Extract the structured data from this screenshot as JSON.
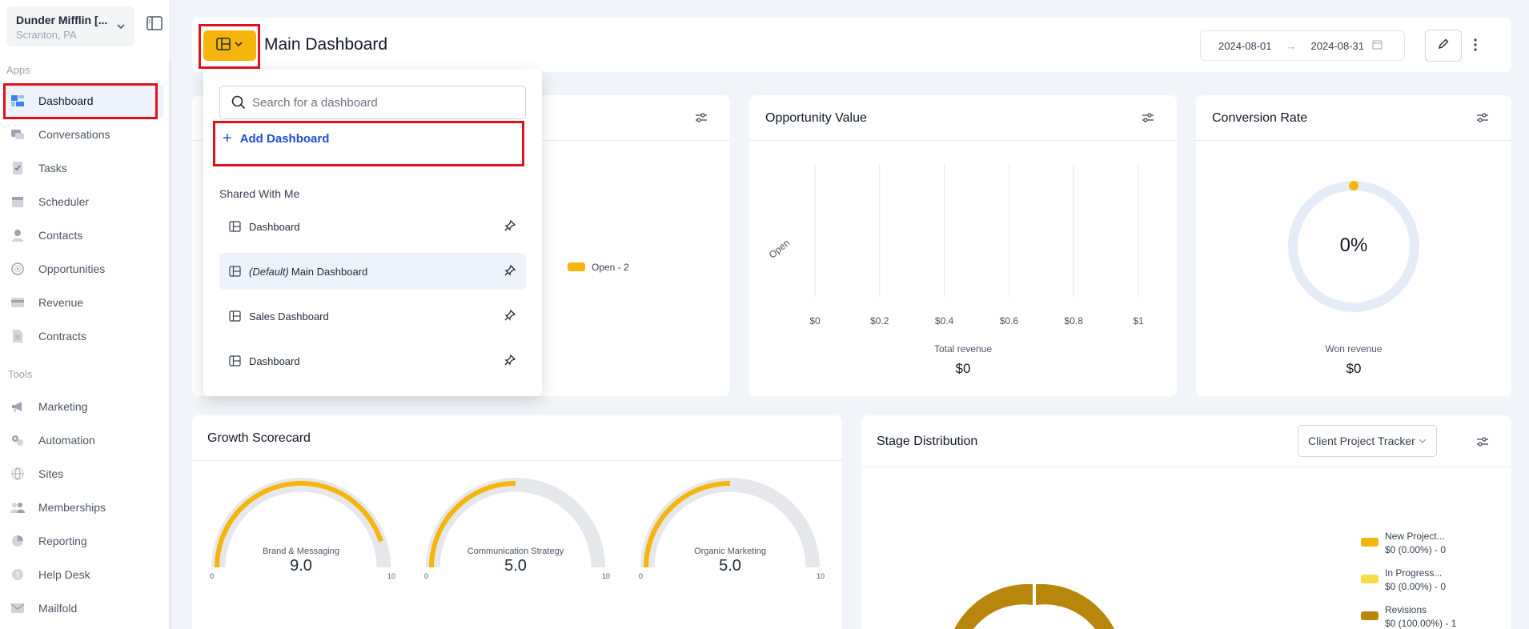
{
  "sidebar": {
    "location_name": "Dunder Mifflin [...",
    "location_sub": "Scranton, PA",
    "apps_label": "Apps",
    "tools_label": "Tools",
    "apps": [
      {
        "label": "Dashboard",
        "icon": "dashboard-icon"
      },
      {
        "label": "Conversations",
        "icon": "chat-icon"
      },
      {
        "label": "Tasks",
        "icon": "task-icon"
      },
      {
        "label": "Scheduler",
        "icon": "calendar-icon"
      },
      {
        "label": "Contacts",
        "icon": "person-icon"
      },
      {
        "label": "Opportunities",
        "icon": "target-icon"
      },
      {
        "label": "Revenue",
        "icon": "card-icon"
      },
      {
        "label": "Contracts",
        "icon": "document-icon"
      }
    ],
    "tools": [
      {
        "label": "Marketing",
        "icon": "megaphone-icon"
      },
      {
        "label": "Automation",
        "icon": "gears-icon"
      },
      {
        "label": "Sites",
        "icon": "globe-icon"
      },
      {
        "label": "Memberships",
        "icon": "people-icon"
      },
      {
        "label": "Reporting",
        "icon": "pie-icon"
      },
      {
        "label": "Help Desk",
        "icon": "help-icon"
      },
      {
        "label": "Mailfold",
        "icon": "mail-icon"
      }
    ]
  },
  "header": {
    "title": "Main Dashboard",
    "date_start": "2024-08-01",
    "date_end": "2024-08-31",
    "arrow": "→"
  },
  "dropdown": {
    "search_placeholder": "Search for a dashboard",
    "add_label": "Add Dashboard",
    "shared_label": "Shared With Me",
    "items": [
      {
        "prefix": "",
        "label": "Dashboard"
      },
      {
        "prefix": "(Default)",
        "label": "Main Dashboard"
      },
      {
        "prefix": "",
        "label": "Sales Dashboard"
      },
      {
        "prefix": "",
        "label": "Dashboard"
      }
    ]
  },
  "card1": {
    "legend": "Open - 2",
    "color": "#f5b50c"
  },
  "opportunity_value": {
    "title": "Opportunity Value",
    "footer_label": "Total revenue",
    "footer_value": "$0",
    "chart_data": {
      "type": "bar",
      "categories": [
        "Open"
      ],
      "x_ticks": [
        "$0",
        "$0.2",
        "$0.4",
        "$0.6",
        "$0.8",
        "$1"
      ],
      "values": [
        0
      ],
      "xlim": [
        0,
        1
      ],
      "orientation": "horizontal"
    }
  },
  "conversion_rate": {
    "title": "Conversion Rate",
    "value": "0%",
    "footer_label": "Won revenue",
    "footer_value": "$0"
  },
  "growth_scorecard": {
    "title": "Growth Scorecard",
    "gauges": [
      {
        "label": "Brand & Messaging",
        "value": "9.0",
        "score": 9,
        "min": "0",
        "max": "10"
      },
      {
        "label": "Communication Strategy",
        "value": "5.0",
        "score": 5,
        "min": "0",
        "max": "10"
      },
      {
        "label": "Organic Marketing",
        "value": "5.0",
        "score": 5,
        "min": "0",
        "max": "10"
      }
    ]
  },
  "stage_distribution": {
    "title": "Stage Distribution",
    "pipeline": "Client Project Tracker",
    "legend": [
      {
        "name": "New Project...",
        "detail": "$0 (0.00%) - 0",
        "color": "#f5b50c"
      },
      {
        "name": "In Progress...",
        "detail": "$0 (0.00%) - 0",
        "color": "#f7dc4a"
      },
      {
        "name": "Revisions",
        "detail": "$0 (100.00%) - 1",
        "color": "#b8860b"
      }
    ]
  },
  "colors": {
    "accent": "#f5b50c",
    "highlight": "#e0121f",
    "link": "#1d4ed8"
  }
}
